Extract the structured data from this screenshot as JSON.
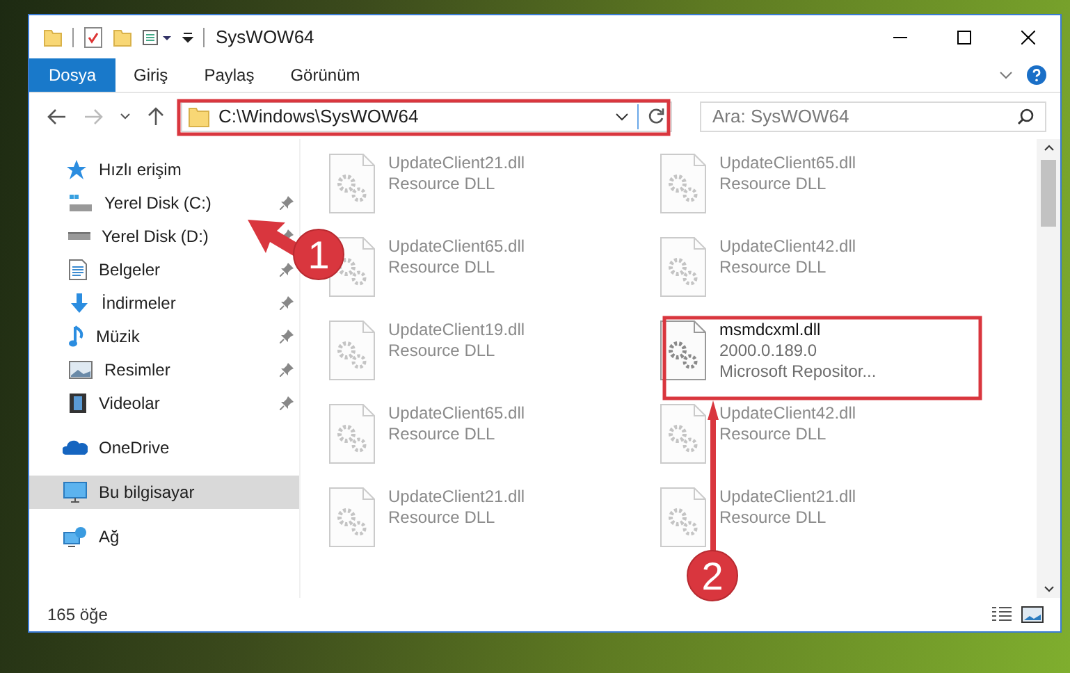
{
  "window": {
    "title": "SysWOW64"
  },
  "ribbon_tabs": [
    {
      "label": "Dosya",
      "selected": true
    },
    {
      "label": "Giriş",
      "selected": false
    },
    {
      "label": "Paylaş",
      "selected": false
    },
    {
      "label": "Görünüm",
      "selected": false
    }
  ],
  "address_bar": {
    "path": "C:\\Windows\\SysWOW64"
  },
  "search": {
    "placeholder": "Ara: SysWOW64"
  },
  "sidebar": {
    "items": [
      {
        "label": "Hızlı erişim",
        "selected": false,
        "children": [
          {
            "label": "Yerel Disk (C:)",
            "pinned": true
          },
          {
            "label": "Yerel Disk (D:)",
            "pinned": true
          },
          {
            "label": "Belgeler",
            "pinned": true
          },
          {
            "label": "İndirmeler",
            "pinned": true
          },
          {
            "label": "Müzik",
            "pinned": true
          },
          {
            "label": "Resimler",
            "pinned": true
          },
          {
            "label": "Videolar",
            "pinned": true
          }
        ]
      },
      {
        "label": "OneDrive",
        "selected": false
      },
      {
        "label": "Bu bilgisayar",
        "selected": true
      },
      {
        "label": "Ağ",
        "selected": false
      }
    ]
  },
  "files": [
    {
      "name": "UpdateClient21.dll",
      "description": "Resource DLL",
      "faded": true
    },
    {
      "name": "UpdateClient65.dll",
      "description": "Resource DLL",
      "faded": true
    },
    {
      "name": "UpdateClient65.dll",
      "description": "Resource DLL",
      "faded": true
    },
    {
      "name": "UpdateClient42.dll",
      "description": "Resource DLL",
      "faded": true
    },
    {
      "name": "UpdateClient19.dll",
      "description": "Resource DLL",
      "faded": true
    },
    {
      "name": "msmdcxml.dll",
      "version": "2000.0.189.0",
      "description": "Microsoft Repositor...",
      "faded": false
    },
    {
      "name": "UpdateClient65.dll",
      "description": "Resource DLL",
      "faded": true
    },
    {
      "name": "UpdateClient42.dll",
      "description": "Resource DLL",
      "faded": true
    },
    {
      "name": "UpdateClient21.dll",
      "description": "Resource DLL",
      "faded": true
    },
    {
      "name": "UpdateClient21.dll",
      "description": "Resource DLL",
      "faded": true
    }
  ],
  "status_bar": {
    "item_count": "165 öğe"
  },
  "callouts": [
    {
      "number": "1"
    },
    {
      "number": "2"
    }
  ]
}
